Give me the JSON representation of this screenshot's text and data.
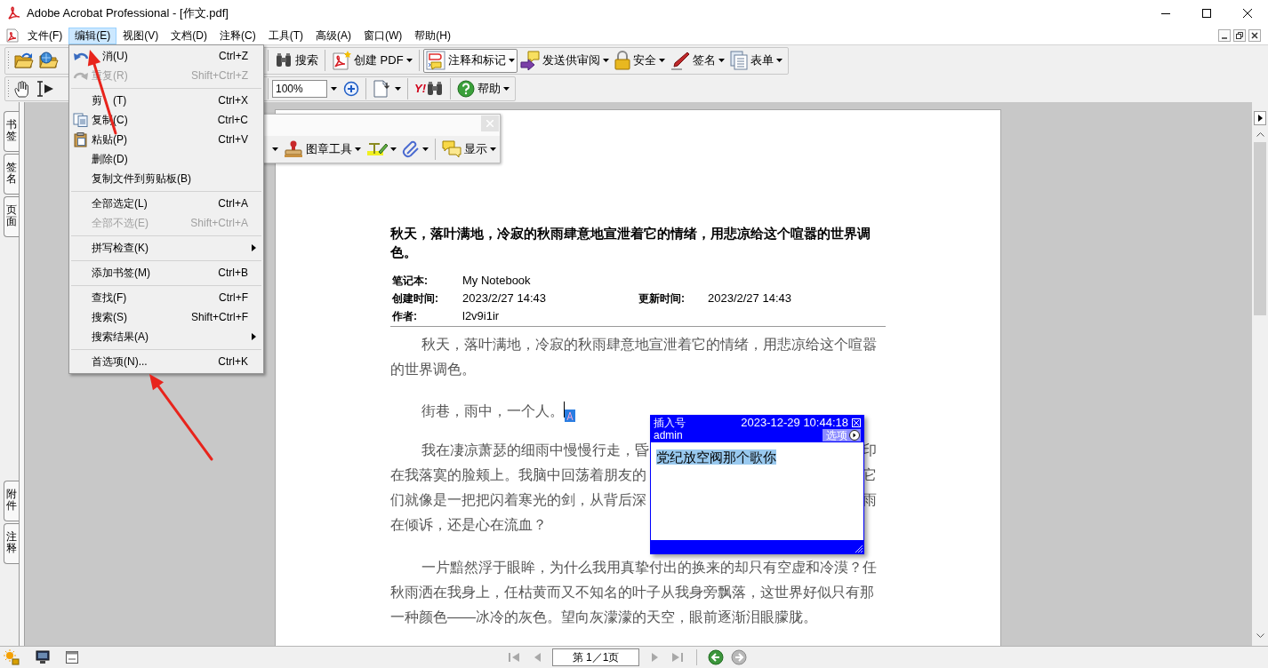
{
  "window": {
    "title": "Adobe Acrobat Professional - [作文.pdf]"
  },
  "menu_bar": [
    {
      "label": "文件(F)",
      "selected": false
    },
    {
      "label": "编辑(E)",
      "selected": true
    },
    {
      "label": "视图(V)",
      "selected": false
    },
    {
      "label": "文档(D)",
      "selected": false
    },
    {
      "label": "注释(C)",
      "selected": false
    },
    {
      "label": "工具(T)",
      "selected": false
    },
    {
      "label": "高级(A)",
      "selected": false
    },
    {
      "label": "窗口(W)",
      "selected": false
    },
    {
      "label": "帮助(H)",
      "selected": false
    }
  ],
  "toolbar_1": {
    "groups": [
      [
        {
          "dropdown": false,
          "pressed": false
        },
        {
          "dropdown": false,
          "pressed": false
        }
      ],
      [
        {
          "label": "搜索",
          "dropdown": false,
          "pressed": false
        }
      ],
      [
        {
          "label": "创建 PDF",
          "dropdown": true,
          "pressed": false
        }
      ],
      [
        {
          "label": "注释和标记",
          "dropdown": true,
          "pressed": true
        },
        {
          "label": "发送供审阅",
          "dropdown": true,
          "pressed": false
        },
        {
          "label": "安全",
          "dropdown": true,
          "pressed": false
        },
        {
          "label": "签名",
          "dropdown": true,
          "pressed": false
        },
        {
          "label": "表单",
          "dropdown": true,
          "pressed": false
        }
      ]
    ]
  },
  "toolbar_2": {
    "groups": [
      [
        {
          "kind": "button",
          "dropdown": false
        },
        {
          "kind": "button",
          "dropdown": false
        }
      ],
      [
        {
          "kind": "zoom_field",
          "value": "100%",
          "dropdown": true
        },
        {
          "kind": "button",
          "dropdown": false
        }
      ],
      [
        {
          "kind": "button",
          "dropdown": true
        }
      ],
      [
        {
          "kind": "logo_button",
          "label": "Y!",
          "dropdown": false
        }
      ],
      [
        {
          "kind": "button",
          "label": "帮助",
          "dropdown": true
        }
      ]
    ]
  },
  "floating_toolbar": {
    "groups": [
      [
        {
          "dropdown": true
        },
        {
          "label": "图章工具",
          "dropdown": true
        },
        {
          "dropdown": true
        },
        {
          "dropdown": true
        }
      ],
      [
        {
          "label": "显示",
          "dropdown": true
        }
      ]
    ]
  },
  "edit_menu": {
    "groups": [
      [
        {
          "kind": "covered_start",
          "label": "消(U)",
          "shortcut": "Ctrl+Z",
          "disabled": false,
          "submenu": false
        },
        {
          "kind": "item",
          "label": "重复(R)",
          "shortcut": "Shift+Ctrl+Z",
          "disabled": true,
          "submenu": false
        }
      ],
      [
        {
          "kind": "covered_middle",
          "label": "剪",
          "label_tail": "(T)",
          "shortcut": "Ctrl+X",
          "disabled": false,
          "submenu": false
        },
        {
          "kind": "item",
          "label": "复制(C)",
          "shortcut": "Ctrl+C",
          "disabled": false,
          "submenu": false
        },
        {
          "kind": "item",
          "label": "粘贴(P)",
          "shortcut": "Ctrl+V",
          "disabled": false,
          "submenu": false
        },
        {
          "kind": "item",
          "label": "删除(D)",
          "disabled": false,
          "submenu": false
        },
        {
          "kind": "item",
          "label": "复制文件到剪贴板(B)",
          "disabled": false,
          "submenu": false
        }
      ],
      [
        {
          "kind": "item",
          "label": "全部选定(L)",
          "shortcut": "Ctrl+A",
          "disabled": false,
          "submenu": false
        },
        {
          "kind": "item",
          "label": "全部不选(E)",
          "shortcut": "Shift+Ctrl+A",
          "disabled": true,
          "submenu": false
        }
      ],
      [
        {
          "kind": "item",
          "label": "拼写检查(K)",
          "disabled": false,
          "submenu": true
        }
      ],
      [
        {
          "kind": "item",
          "label": "添加书签(M)",
          "shortcut": "Ctrl+B",
          "disabled": false,
          "submenu": false
        }
      ],
      [
        {
          "kind": "item",
          "label": "查找(F)",
          "shortcut": "Ctrl+F",
          "disabled": false,
          "submenu": false
        },
        {
          "kind": "item",
          "label": "搜索(S)",
          "shortcut": "Shift+Ctrl+F",
          "disabled": false,
          "submenu": false
        },
        {
          "kind": "item",
          "label": "搜索结果(A)",
          "disabled": false,
          "submenu": true
        }
      ],
      [
        {
          "kind": "item",
          "label": "首选项(N)...",
          "shortcut": "Ctrl+K",
          "disabled": false,
          "submenu": false
        }
      ]
    ]
  },
  "side_tabs": {
    "top": [
      {
        "label": "书签"
      },
      {
        "label": "签名"
      },
      {
        "label": "页面"
      }
    ],
    "bottom": [
      {
        "label": "附件"
      },
      {
        "label": "注释"
      }
    ]
  },
  "document": {
    "heading": "秋天，落叶满地，冷寂的秋雨肆意地宣泄着它的情绪，用悲凉给这个喧嚣的世界调色。",
    "meta_rows": [
      [
        {
          "label": "笔记本:",
          "value": "My Notebook"
        }
      ],
      [
        {
          "label": "创建时间:",
          "value": "2023/2/27 14:43"
        },
        {
          "label": "更新时间:",
          "value": "2023/2/27 14:43"
        }
      ],
      [
        {
          "label": "作者:",
          "value": "l2v9i1ir"
        }
      ]
    ],
    "paragraphs": [
      {
        "kind": "text",
        "text": "秋天，落叶满地，冷寂的秋雨肆意地宣泄着它的情绪，用悲凉给这个喧嚣的世界调色。"
      },
      {
        "kind": "text_with_note",
        "text": "街巷，雨中，一个人。"
      },
      {
        "kind": "lines",
        "lines": [
          {
            "left": "我在凄凉萧瑟的细雨中慢慢行走，昏",
            "right": "印"
          },
          {
            "left": "在我落寞的脸颊上。我脑中回荡着朋友的",
            "right": "它"
          },
          {
            "left": "们就像是一把把闪着寒光的剑，从背后深",
            "right": "雨"
          },
          {
            "left": "在倾诉，还是心在流血？"
          }
        ]
      },
      {
        "kind": "text",
        "text": "一片黯然浮于眼眸，为什么我用真挚付出的换来的却只有空虚和冷漠？任秋雨洒在我身上，任枯黄而又不知名的叶子从我身旁飘落，这世界好似只有那一种颜色——冰冷的灰色。望向灰濛濛的天空，眼前逐渐泪眼朦胧。"
      }
    ]
  },
  "note_popup": {
    "type": "插入号",
    "date": "2023-12-29 10:44:18",
    "author": "admin",
    "options_label": "选项",
    "text": "党纪放空阀那个歌你",
    "text_selected": true
  },
  "status_bar": {
    "nav_before": [
      {
        "disabled": true
      },
      {
        "disabled": true
      }
    ],
    "page_field": "第 1／1页",
    "nav_after": [
      {
        "disabled": true
      },
      {
        "disabled": true
      }
    ],
    "history": [
      {
        "disabled": false
      },
      {
        "disabled": true
      }
    ]
  }
}
